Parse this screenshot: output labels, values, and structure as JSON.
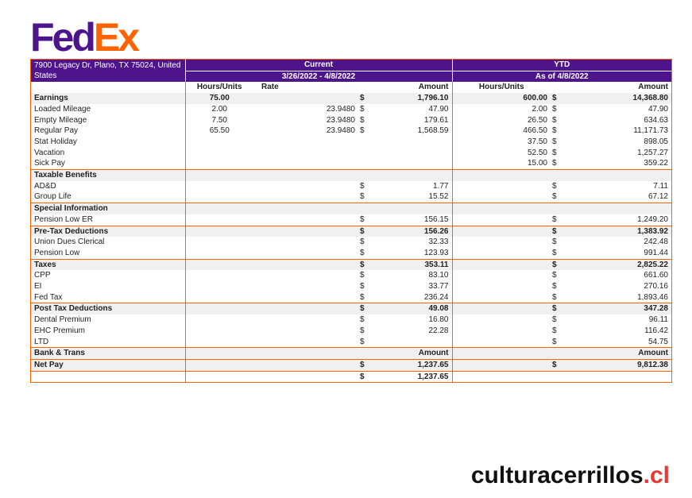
{
  "logo": {
    "part1": "Fed",
    "part2": "Ex"
  },
  "address": "7900 Legacy Dr, Plano, TX 75024, United States",
  "header": {
    "current": "Current",
    "ytd": "YTD",
    "current_period": "3/26/2022 - 4/8/2022",
    "ytd_period": "As of 4/8/2022"
  },
  "columns": {
    "hours": "Hours/Units",
    "rate": "Rate",
    "amount": "Amount",
    "ytd_hours": "Hours/Units",
    "ytd_amount": "Amount"
  },
  "currency": "$",
  "sections": {
    "earnings": {
      "label": "Earnings",
      "hours": "75.00",
      "amount": "1,796.10",
      "ytd_hours": "600.00",
      "ytd_amount": "14,368.80"
    },
    "earnings_rows": [
      {
        "label": "Loaded Mileage",
        "hours": "2.00",
        "rate": "23.9480",
        "amount": "47.90",
        "ytd_hours": "2.00",
        "ytd_amount": "47.90"
      },
      {
        "label": "Empty Mileage",
        "hours": "7.50",
        "rate": "23.9480",
        "amount": "179.61",
        "ytd_hours": "26.50",
        "ytd_amount": "634.63"
      },
      {
        "label": "Regular Pay",
        "hours": "65.50",
        "rate": "23.9480",
        "amount": "1,568.59",
        "ytd_hours": "466.50",
        "ytd_amount": "11,171.73"
      },
      {
        "label": "Stat Holiday",
        "ytd_hours": "37.50",
        "ytd_amount": "898.05"
      },
      {
        "label": "Vacation",
        "ytd_hours": "52.50",
        "ytd_amount": "1,257.27"
      },
      {
        "label": "Sick Pay",
        "ytd_hours": "15.00",
        "ytd_amount": "359.22"
      }
    ],
    "taxable": {
      "label": "Taxable Benefits"
    },
    "taxable_rows": [
      {
        "label": "AD&D",
        "amount": "1.77",
        "ytd_amount": "7.11"
      },
      {
        "label": "Group Life",
        "amount": "15.52",
        "ytd_amount": "67.12"
      }
    ],
    "special": {
      "label": "Special Information"
    },
    "special_rows": [
      {
        "label": "Pension Low ER",
        "amount": "156.15",
        "ytd_amount": "1,249.20"
      }
    ],
    "pretax": {
      "label": "Pre-Tax Deductions",
      "amount": "156.26",
      "ytd_amount": "1,383.92"
    },
    "pretax_rows": [
      {
        "label": "Union Dues Clerical",
        "amount": "32.33",
        "ytd_amount": "242.48"
      },
      {
        "label": "Pension Low",
        "amount": "123.93",
        "ytd_amount": "991.44"
      }
    ],
    "taxes": {
      "label": "Taxes",
      "amount": "353.11",
      "ytd_amount": "2,825.22"
    },
    "taxes_rows": [
      {
        "label": "CPP",
        "amount": "83.10",
        "ytd_amount": "661.60"
      },
      {
        "label": "EI",
        "amount": "33.77",
        "ytd_amount": "270.16"
      },
      {
        "label": "Fed Tax",
        "amount": "236.24",
        "ytd_amount": "1,893.46"
      }
    ],
    "posttax": {
      "label": "Post Tax Deductions",
      "amount": "49.08",
      "ytd_amount": "347.28"
    },
    "posttax_rows": [
      {
        "label": "Dental Premium",
        "amount": "16.80",
        "ytd_amount": "96.11"
      },
      {
        "label": "EHC Premium",
        "amount": "22.28",
        "ytd_amount": "116.42"
      },
      {
        "label": "LTD",
        "amount": "",
        "ytd_amount": "54.75"
      }
    ],
    "bank": {
      "label": "Bank & Trans",
      "amount_label": "Amount",
      "ytd_amount_label": "Amount"
    },
    "netpay": {
      "label": "Net Pay",
      "amount": "1,237.65",
      "ytd_amount": "9,812.38",
      "total": "1,237.65"
    }
  },
  "watermark": {
    "main": "culturacerrillos",
    "tld": ".cl"
  },
  "colors": {
    "purple": "#4d148c",
    "orange": "#ff6200",
    "watermark_red": "#e53935"
  }
}
